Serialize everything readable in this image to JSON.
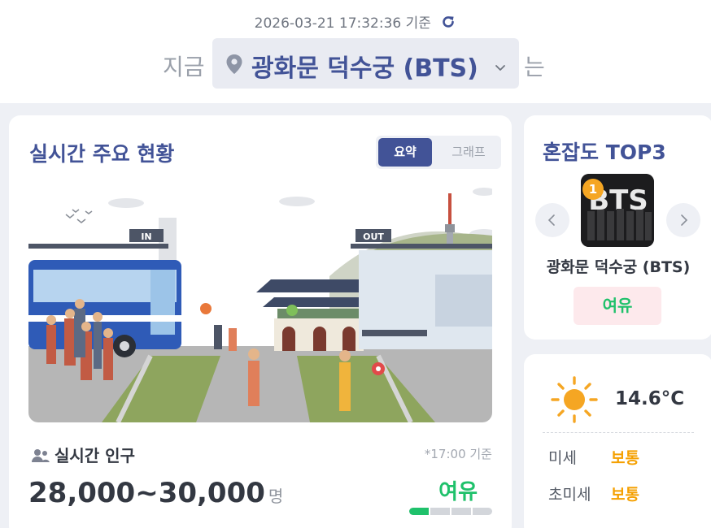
{
  "header": {
    "timestamp": "2026-03-21 17:32:36 기준",
    "prefix": "지금",
    "location": "광화문 덕수궁 (BTS)",
    "suffix": "는"
  },
  "main": {
    "title": "실시간 주요 현황",
    "tabs": [
      {
        "label": "요약",
        "active": true
      },
      {
        "label": "그래프",
        "active": false
      }
    ],
    "scene": {
      "in_sign": "IN",
      "out_sign": "OUT"
    },
    "population": {
      "label": "실시간 인구",
      "time_note": "*17:00 기준",
      "value": "28,000~30,000",
      "unit": "명",
      "status": "여유",
      "level_fraction": 0.25
    }
  },
  "top3": {
    "title": "혼잡도 TOP3",
    "rank": "1",
    "name": "광화문 덕수궁 (BTS)",
    "status": "여유",
    "thumb_text": "BTS"
  },
  "weather": {
    "icon": "sun-icon",
    "temperature": "14.6°C",
    "rows": [
      {
        "label": "미세",
        "value": "보통"
      },
      {
        "label": "초미세",
        "value": "보통"
      }
    ]
  },
  "colors": {
    "accent": "#425397",
    "good": "#1fc16b",
    "normal": "#f5a000",
    "background": "#eef0f5"
  }
}
